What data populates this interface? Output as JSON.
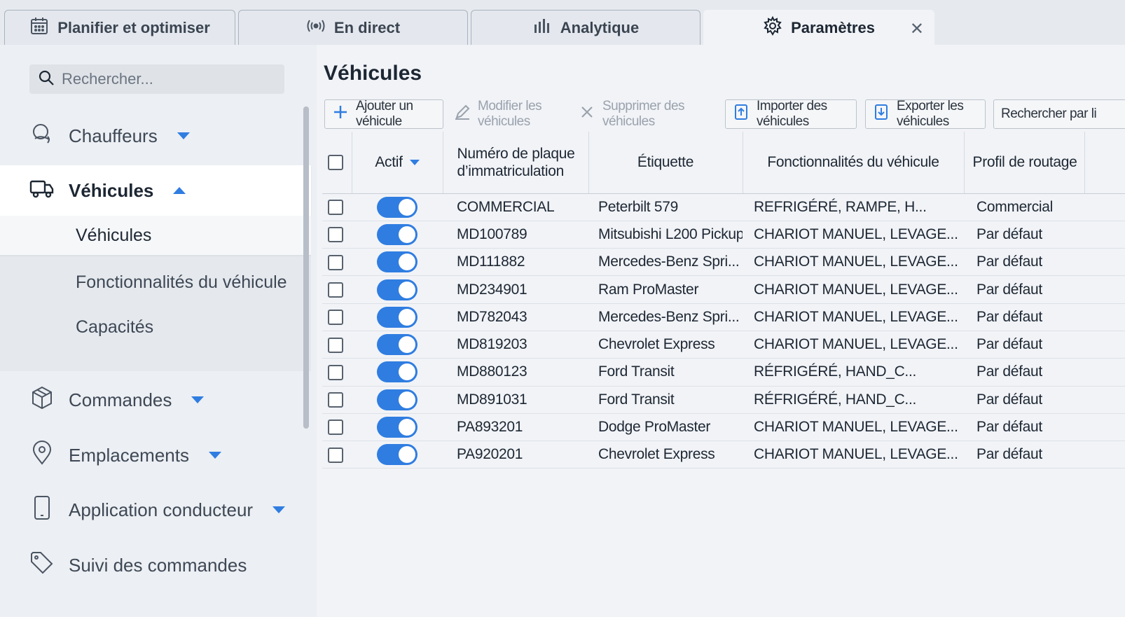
{
  "tabs": [
    {
      "label": "Planifier et optimiser",
      "icon": "calendar-icon"
    },
    {
      "label": "En direct",
      "icon": "broadcast-icon"
    },
    {
      "label": "Analytique",
      "icon": "bar-chart-icon"
    },
    {
      "label": "Paramètres",
      "icon": "gear-icon",
      "active": true,
      "close": "✕"
    }
  ],
  "sidebar": {
    "search_placeholder": "Rechercher...",
    "items": [
      {
        "label": "Chauffeurs",
        "icon": "driver-icon"
      },
      {
        "label": "Véhicules",
        "icon": "truck-icon",
        "expanded": true
      },
      {
        "label": "Commandes",
        "icon": "package-icon"
      },
      {
        "label": "Emplacements",
        "icon": "location-pin-icon"
      },
      {
        "label": "Application conducteur",
        "icon": "phone-icon"
      },
      {
        "label": "Suivi des commandes",
        "icon": "tag-icon"
      }
    ],
    "subitems": [
      {
        "label": "Véhicules",
        "active": true
      },
      {
        "label": "Fonctionnalités du véhicule"
      },
      {
        "label": "Capacités"
      }
    ]
  },
  "main": {
    "title": "Véhicules",
    "toolbar": {
      "add": "Ajouter un véhicule",
      "edit": "Modifier les véhicules",
      "delete": "Supprimer des véhicules",
      "import": "Importer des véhicules",
      "export": "Exporter les véhicules",
      "search_by": "Rechercher par li"
    },
    "columns": {
      "active": "Actif",
      "plate_line1": "Numéro de plaque",
      "plate_line2": "d’immatriculation",
      "label": "Étiquette",
      "features": "Fonctionnalités du véhicule",
      "routing": "Profil de routage"
    },
    "rows": [
      {
        "plate": "COMMERCIAL",
        "label": "Peterbilt 579",
        "features": "REFRIGÉRÉ, RAMPE, H...",
        "routing": "Commercial",
        "active": true
      },
      {
        "plate": "MD100789",
        "label": "Mitsubishi L200 Pickup",
        "features": "CHARIOT MANUEL, LEVAGE...",
        "routing": "Par défaut",
        "active": true
      },
      {
        "plate": "MD111882",
        "label": "Mercedes-Benz Spri...",
        "features": "CHARIOT MANUEL, LEVAGE...",
        "routing": "Par défaut",
        "active": true
      },
      {
        "plate": "MD234901",
        "label": "Ram ProMaster",
        "features": "CHARIOT MANUEL, LEVAGE...",
        "routing": "Par défaut",
        "active": true
      },
      {
        "plate": "MD782043",
        "label": "Mercedes-Benz Spri...",
        "features": "CHARIOT MANUEL, LEVAGE...",
        "routing": "Par défaut",
        "active": true
      },
      {
        "plate": "MD819203",
        "label": "Chevrolet Express",
        "features": "CHARIOT MANUEL, LEVAGE...",
        "routing": "Par défaut",
        "active": true
      },
      {
        "plate": "MD880123",
        "label": "Ford Transit",
        "features": "RÉFRIGÉRÉ, HAND_C...",
        "routing": "Par défaut",
        "active": true
      },
      {
        "plate": "MD891031",
        "label": "Ford Transit",
        "features": "RÉFRIGÉRÉ, HAND_C...",
        "routing": "Par défaut",
        "active": true
      },
      {
        "plate": "PA893201",
        "label": "Dodge ProMaster",
        "features": "CHARIOT MANUEL, LEVAGE...",
        "routing": "Par défaut",
        "active": true
      },
      {
        "plate": "PA920201",
        "label": "Chevrolet Express",
        "features": "CHARIOT MANUEL, LEVAGE...",
        "routing": "Par défaut",
        "active": true
      }
    ]
  },
  "colors": {
    "accent": "#2f7de1",
    "background": "#f1f3f7",
    "sidebar": "#eceff3"
  }
}
